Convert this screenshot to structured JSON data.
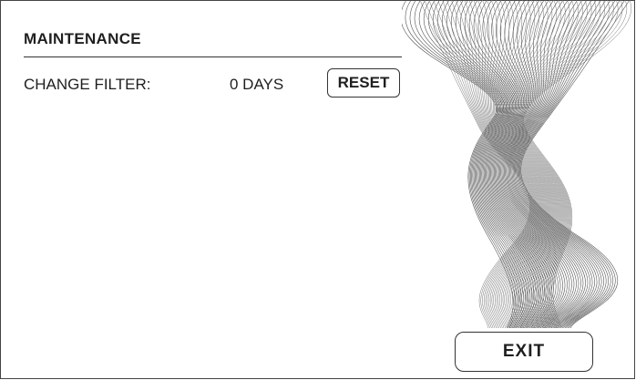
{
  "screen": {
    "title": "MAINTENANCE"
  },
  "filter": {
    "label": "CHANGE FILTER:",
    "value": "0 DAYS",
    "reset_label": "RESET"
  },
  "footer": {
    "exit_label": "EXIT"
  },
  "colors": {
    "text": "#1f1f1f",
    "line": "#333333",
    "background": "#ffffff"
  },
  "decor": {
    "icon": "wave-line-art"
  }
}
